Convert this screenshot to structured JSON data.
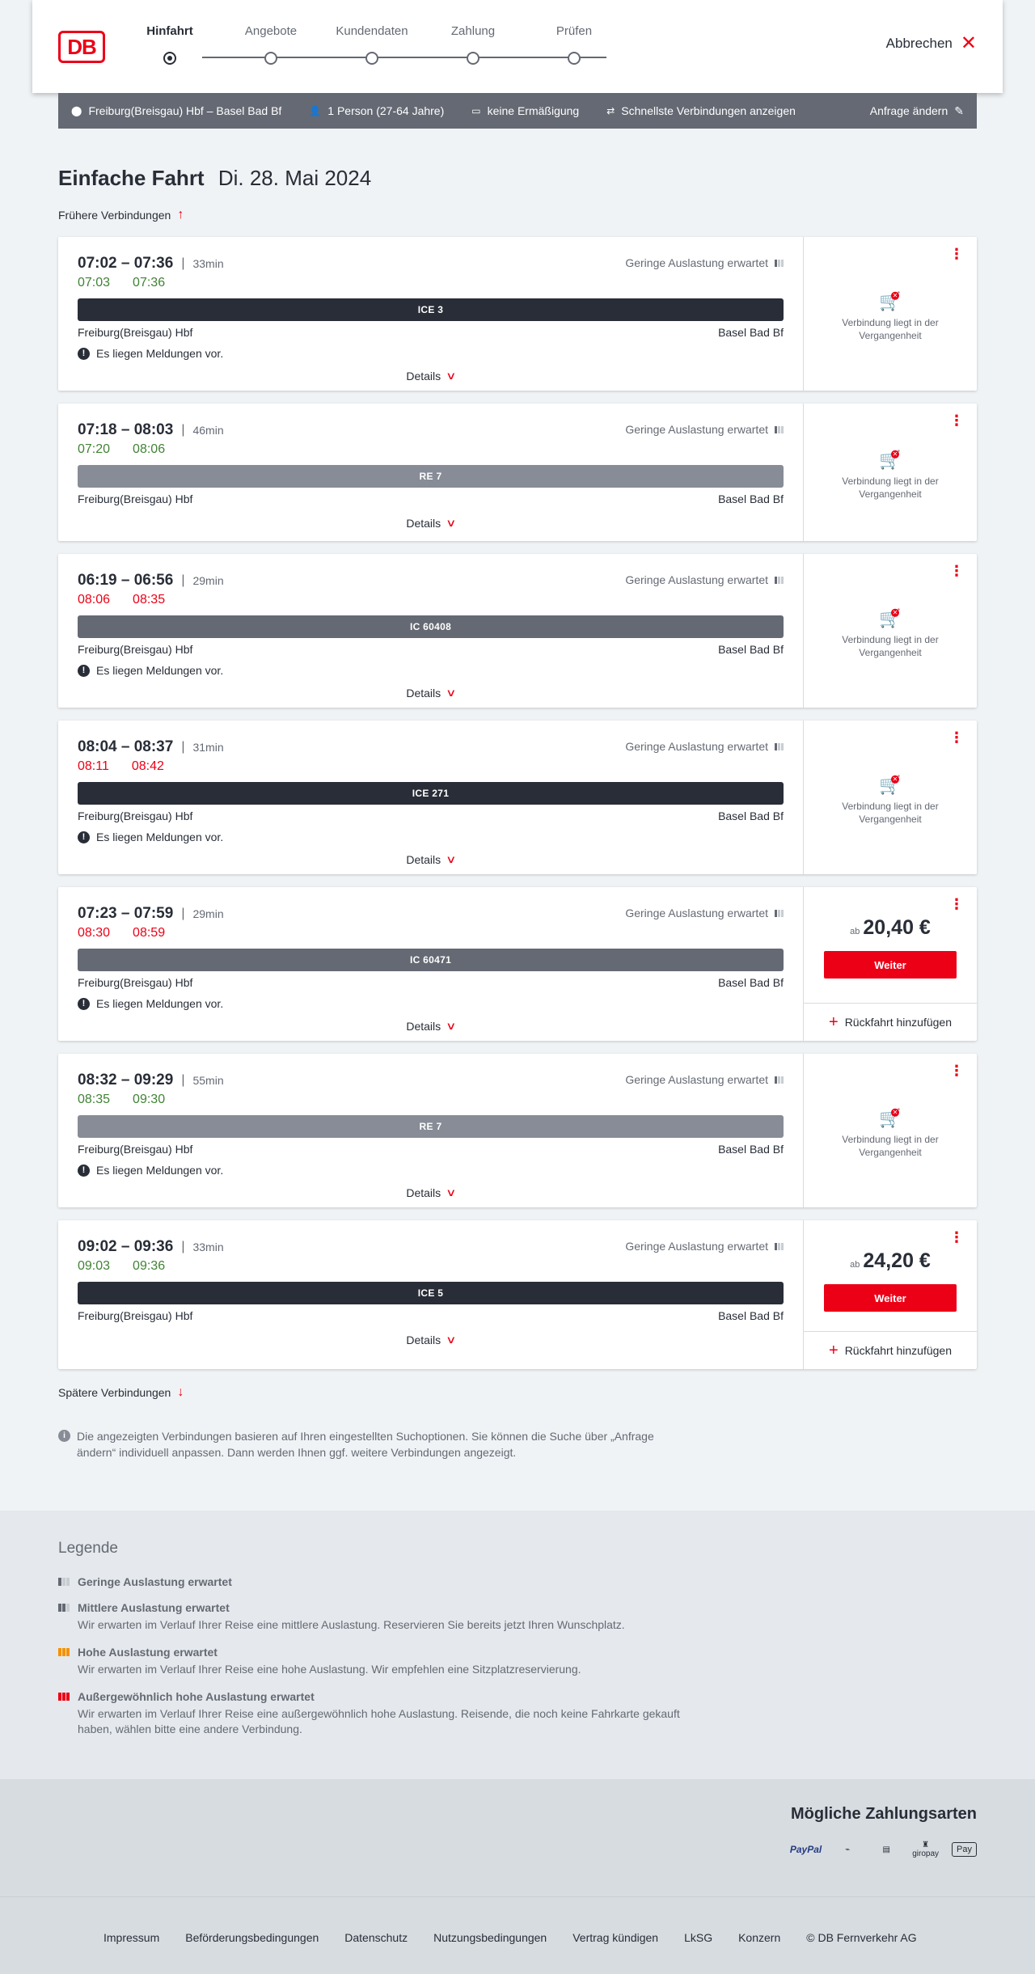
{
  "header": {
    "logo": "DB",
    "steps": [
      {
        "label": "Hinfahrt"
      },
      {
        "label": "Angebote"
      },
      {
        "label": "Kundendaten"
      },
      {
        "label": "Zahlung"
      },
      {
        "label": "Prüfen"
      }
    ],
    "cancel_label": "Abbrechen"
  },
  "summary": {
    "route": "Freiburg(Breisgau) Hbf – Basel Bad Bf",
    "passengers": "1 Person (27-64 Jahre)",
    "discount": "keine Ermäßigung",
    "option": "Schnellste Verbindungen anzeigen",
    "edit_label": "Anfrage ändern"
  },
  "title": {
    "main": "Einfache Fahrt",
    "date": "Di. 28. Mai 2024"
  },
  "earlier_label": "Frühere Verbindungen",
  "later_label": "Spätere Verbindungen",
  "common": {
    "load_text": "Geringe Auslastung erwartet",
    "details_label": "Details",
    "notice_text": "Es liegen Meldungen vor.",
    "past_text": "Verbindung liegt in der Vergangenheit",
    "weiter_label": "Weiter",
    "return_label": "Rückfahrt hinzufügen",
    "price_prefix": "ab"
  },
  "connections": [
    {
      "times": "07:02 – 07:36",
      "duration": "33min",
      "rt_dep": "07:03",
      "rt_arr": "07:36",
      "rt_status": "ok",
      "train": "ICE 3",
      "train_style": "dark",
      "from": "Freiburg(Breisgau) Hbf",
      "to": "Basel Bad Bf",
      "notice": true,
      "price": null
    },
    {
      "times": "07:18 – 08:03",
      "duration": "46min",
      "rt_dep": "07:20",
      "rt_arr": "08:06",
      "rt_status": "ok",
      "train": "RE 7",
      "train_style": "light",
      "from": "Freiburg(Breisgau) Hbf",
      "to": "Basel Bad Bf",
      "notice": false,
      "price": null
    },
    {
      "times": "06:19 – 06:56",
      "duration": "29min",
      "rt_dep": "08:06",
      "rt_arr": "08:35",
      "rt_status": "late",
      "train": "IC 60408",
      "train_style": "mid",
      "from": "Freiburg(Breisgau) Hbf",
      "to": "Basel Bad Bf",
      "notice": true,
      "price": null
    },
    {
      "times": "08:04 – 08:37",
      "duration": "31min",
      "rt_dep": "08:11",
      "rt_arr": "08:42",
      "rt_status": "late",
      "train": "ICE 271",
      "train_style": "dark",
      "from": "Freiburg(Breisgau) Hbf",
      "to": "Basel Bad Bf",
      "notice": true,
      "price": null
    },
    {
      "times": "07:23 – 07:59",
      "duration": "29min",
      "rt_dep": "08:30",
      "rt_arr": "08:59",
      "rt_status": "late",
      "train": "IC 60471",
      "train_style": "mid",
      "from": "Freiburg(Breisgau) Hbf",
      "to": "Basel Bad Bf",
      "notice": true,
      "price": "20,40 €"
    },
    {
      "times": "08:32 – 09:29",
      "duration": "55min",
      "rt_dep": "08:35",
      "rt_arr": "09:30",
      "rt_status": "ok",
      "train": "RE 7",
      "train_style": "light",
      "from": "Freiburg(Breisgau) Hbf",
      "to": "Basel Bad Bf",
      "notice": true,
      "price": null
    },
    {
      "times": "09:02 – 09:36",
      "duration": "33min",
      "rt_dep": "09:03",
      "rt_arr": "09:36",
      "rt_status": "ok",
      "train": "ICE 5",
      "train_style": "dark",
      "from": "Freiburg(Breisgau) Hbf",
      "to": "Basel Bad Bf",
      "notice": false,
      "price": "24,20 €"
    }
  ],
  "info_note": "Die angezeigten Verbindungen basieren auf Ihren eingestellten Suchoptionen. Sie können die Suche über „Anfrage ändern“ individuell anpassen. Dann werden Ihnen ggf. weitere Verbindungen angezeigt.",
  "legend": {
    "title": "Legende",
    "items": [
      {
        "level": "low",
        "head": "Geringe Auslastung erwartet",
        "desc": ""
      },
      {
        "level": "mid",
        "head": "Mittlere Auslastung erwartet",
        "desc": "Wir erwarten im Verlauf Ihrer Reise eine mittlere Auslastung. Reservieren Sie bereits jetzt Ihren Wunschplatz."
      },
      {
        "level": "high",
        "head": "Hohe Auslastung erwartet",
        "desc": "Wir erwarten im Verlauf Ihrer Reise eine hohe Auslastung. Wir empfehlen eine Sitzplatzreservierung."
      },
      {
        "level": "extreme",
        "head": "Außergewöhnlich hohe Auslastung erwartet",
        "desc": "Wir erwarten im Verlauf Ihrer Reise eine außergewöhnlich hohe Auslastung. Reisende, die noch keine Fahrkarte gekauft haben, wählen bitte eine andere Verbindung."
      }
    ]
  },
  "payment": {
    "title": "Mögliche Zahlungsarten",
    "methods": [
      "PayPal",
      "giropay",
      "Pay"
    ]
  },
  "footer": {
    "links": [
      "Impressum",
      "Beförderungsbedingungen",
      "Datenschutz",
      "Nutzungsbedingungen",
      "Vertrag kündigen",
      "LkSG",
      "Konzern",
      "© DB Fernverkehr AG"
    ]
  },
  "colors": {
    "brand_red": "#ec0016",
    "on_time_green": "#408335",
    "text_dark": "#282d37",
    "text_grey": "#646973"
  }
}
